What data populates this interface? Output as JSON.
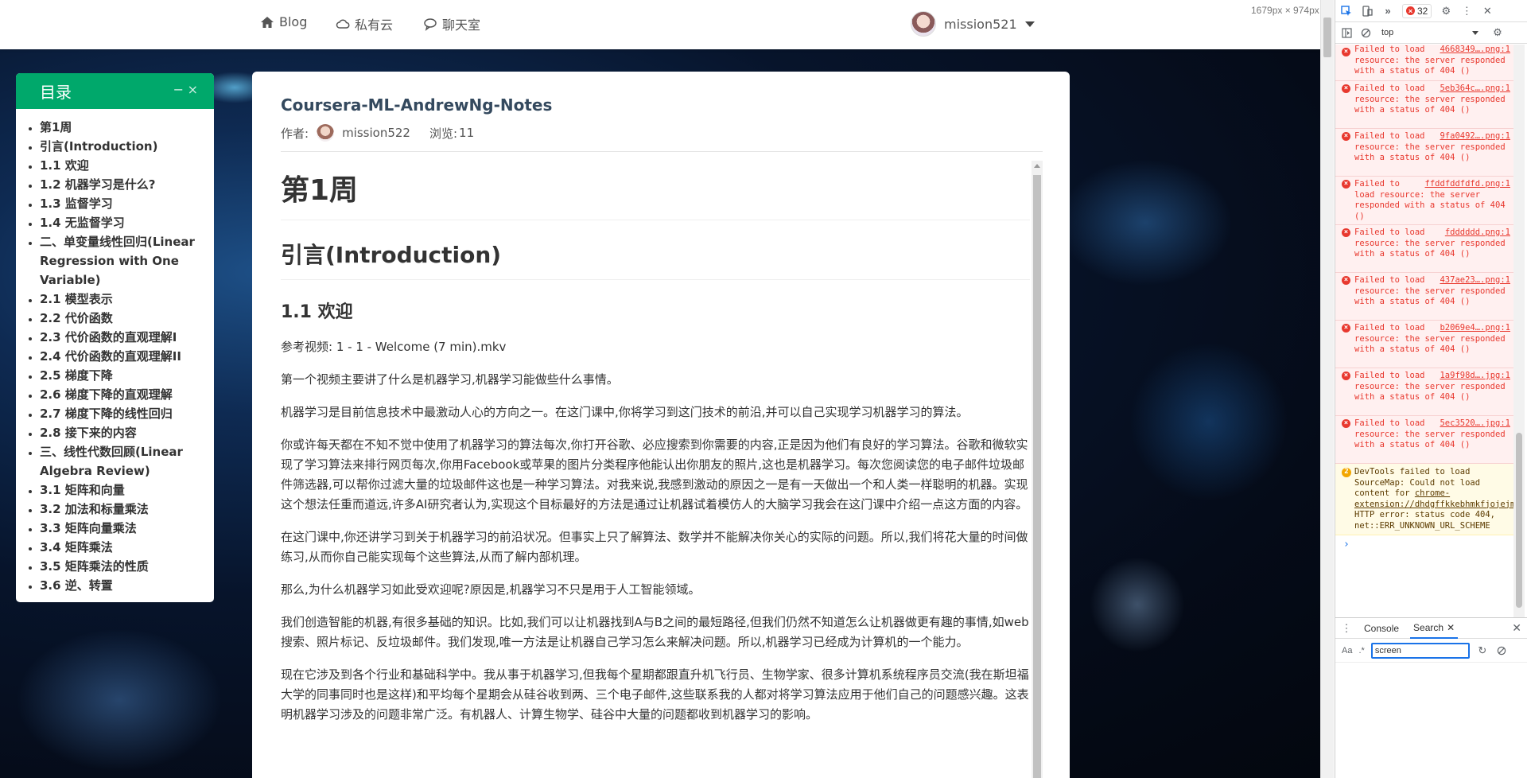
{
  "navbar": {
    "links": [
      {
        "label": "Blog",
        "icon": "home-icon"
      },
      {
        "label": "私有云",
        "icon": "cloud-icon"
      },
      {
        "label": "聊天室",
        "icon": "chat-icon"
      }
    ],
    "username": "mission521"
  },
  "viewport_size_label": "1679px × 974px",
  "toc": {
    "title": "目录",
    "minimize": "−",
    "close": "×",
    "items": [
      "第1周",
      "引言(Introduction)",
      "1.1 欢迎",
      "1.2 机器学习是什么?",
      "1.3 监督学习",
      "1.4 无监督学习",
      "二、单变量线性回归(Linear Regression with One Variable)",
      "2.1 模型表示",
      "2.2 代价函数",
      "2.3 代价函数的直观理解I",
      "2.4 代价函数的直观理解II",
      "2.5 梯度下降",
      "2.6 梯度下降的直观理解",
      "2.7 梯度下降的线性回归",
      "2.8 接下来的内容",
      "三、线性代数回顾(Linear Algebra Review)",
      "3.1 矩阵和向量",
      "3.2 加法和标量乘法",
      "3.3 矩阵向量乘法",
      "3.4 矩阵乘法",
      "3.5 矩阵乘法的性质",
      "3.6 逆、转置"
    ]
  },
  "article": {
    "title": "Coursera-ML-AndrewNg-Notes",
    "author_label": "作者:",
    "author": "mission522",
    "views_label": "浏览:",
    "views": "11",
    "h1": "第1周",
    "h2": "引言(Introduction)",
    "h3": "1.1 欢迎",
    "paragraphs": [
      "参考视频: 1 - 1 - Welcome (7 min).mkv",
      "第一个视频主要讲了什么是机器学习,机器学习能做些什么事情。",
      "机器学习是目前信息技术中最激动人心的方向之一。在这门课中,你将学习到这门技术的前沿,并可以自己实现学习机器学习的算法。",
      "你或许每天都在不知不觉中使用了机器学习的算法每次,你打开谷歌、必应搜索到你需要的内容,正是因为他们有良好的学习算法。谷歌和微软实现了学习算法来排行网页每次,你用Facebook或苹果的图片分类程序他能认出你朋友的照片,这也是机器学习。每次您阅读您的电子邮件垃圾邮件筛选器,可以帮你过滤大量的垃圾邮件这也是一种学习算法。对我来说,我感到激动的原因之一是有一天做出一个和人类一样聪明的机器。实现这个想法任重而道远,许多AI研究者认为,实现这个目标最好的方法是通过让机器试着模仿人的大脑学习我会在这门课中介绍一点这方面的内容。",
      "在这门课中,你还讲学习到关于机器学习的前沿状况。但事实上只了解算法、数学并不能解决你关心的实际的问题。所以,我们将花大量的时间做练习,从而你自己能实现每个这些算法,从而了解内部机理。",
      "那么,为什么机器学习如此受欢迎呢?原因是,机器学习不只是用于人工智能领域。",
      "我们创造智能的机器,有很多基础的知识。比如,我们可以让机器找到A与B之间的最短路径,但我们仍然不知道怎么让机器做更有趣的事情,如web搜索、照片标记、反垃圾邮件。我们发现,唯一方法是让机器自己学习怎么来解决问题。所以,机器学习已经成为计算机的一个能力。",
      "现在它涉及到各个行业和基础科学中。我从事于机器学习,但我每个星期都跟直升机飞行员、生物学家、很多计算机系统程序员交流(我在斯坦福大学的同事同时也是这样)和平均每个星期会从硅谷收到两、三个电子邮件,这些联系我的人都对将学习算法应用于他们自己的问题感兴趣。这表明机器学习涉及的问题非常广泛。有机器人、计算生物学、硅谷中大量的问题都收到机器学习的影响。"
    ]
  },
  "devtools": {
    "error_count": "32",
    "context": "top",
    "errors": [
      {
        "text": "Failed to load resource: the server responded with a status of 404 ()",
        "src": "4668349….png:1"
      },
      {
        "text": "Failed to load resource: the server responded with a status of 404 ()",
        "src": "5eb364c….png:1"
      },
      {
        "text": "Failed to load resource: the server responded with a status of 404 ()",
        "src": "9fa0492….png:1"
      },
      {
        "text": "Failed to load resource: the server responded with a status of 404 ()",
        "src": "ffddfddfdfd.png:1"
      },
      {
        "text": "Failed to load resource: the server responded with a status of 404 ()",
        "src": "fdddddd.png:1"
      },
      {
        "text": "Failed to load resource: the server responded with a status of 404 ()",
        "src": "437ae23….png:1"
      },
      {
        "text": "Failed to load resource: the server responded with a status of 404 ()",
        "src": "b2069e4….png:1"
      },
      {
        "text": "Failed to load resource: the server responded with a status of 404 ()",
        "src": "1a9f98d….jpg:1"
      },
      {
        "text": "Failed to load resource: the server responded with a status of 404 ()",
        "src": "5ec3520….jpg:1"
      }
    ],
    "warning": {
      "count": "2",
      "text_before": "DevTools failed to load SourceMap: Could not load content for ",
      "link": "chrome-extension://dhdgffkkebhmkfjojejmpbldmpobfkfo/jquery.min.map",
      "text_after": ": HTTP error: status code 404, net::ERR_UNKNOWN_URL_SCHEME"
    },
    "prompt": "›",
    "drawer": {
      "tab_console": "Console",
      "tab_search": "Search",
      "search_value": "screen",
      "aa_label": "Aa",
      "regex_label": ".*"
    }
  }
}
